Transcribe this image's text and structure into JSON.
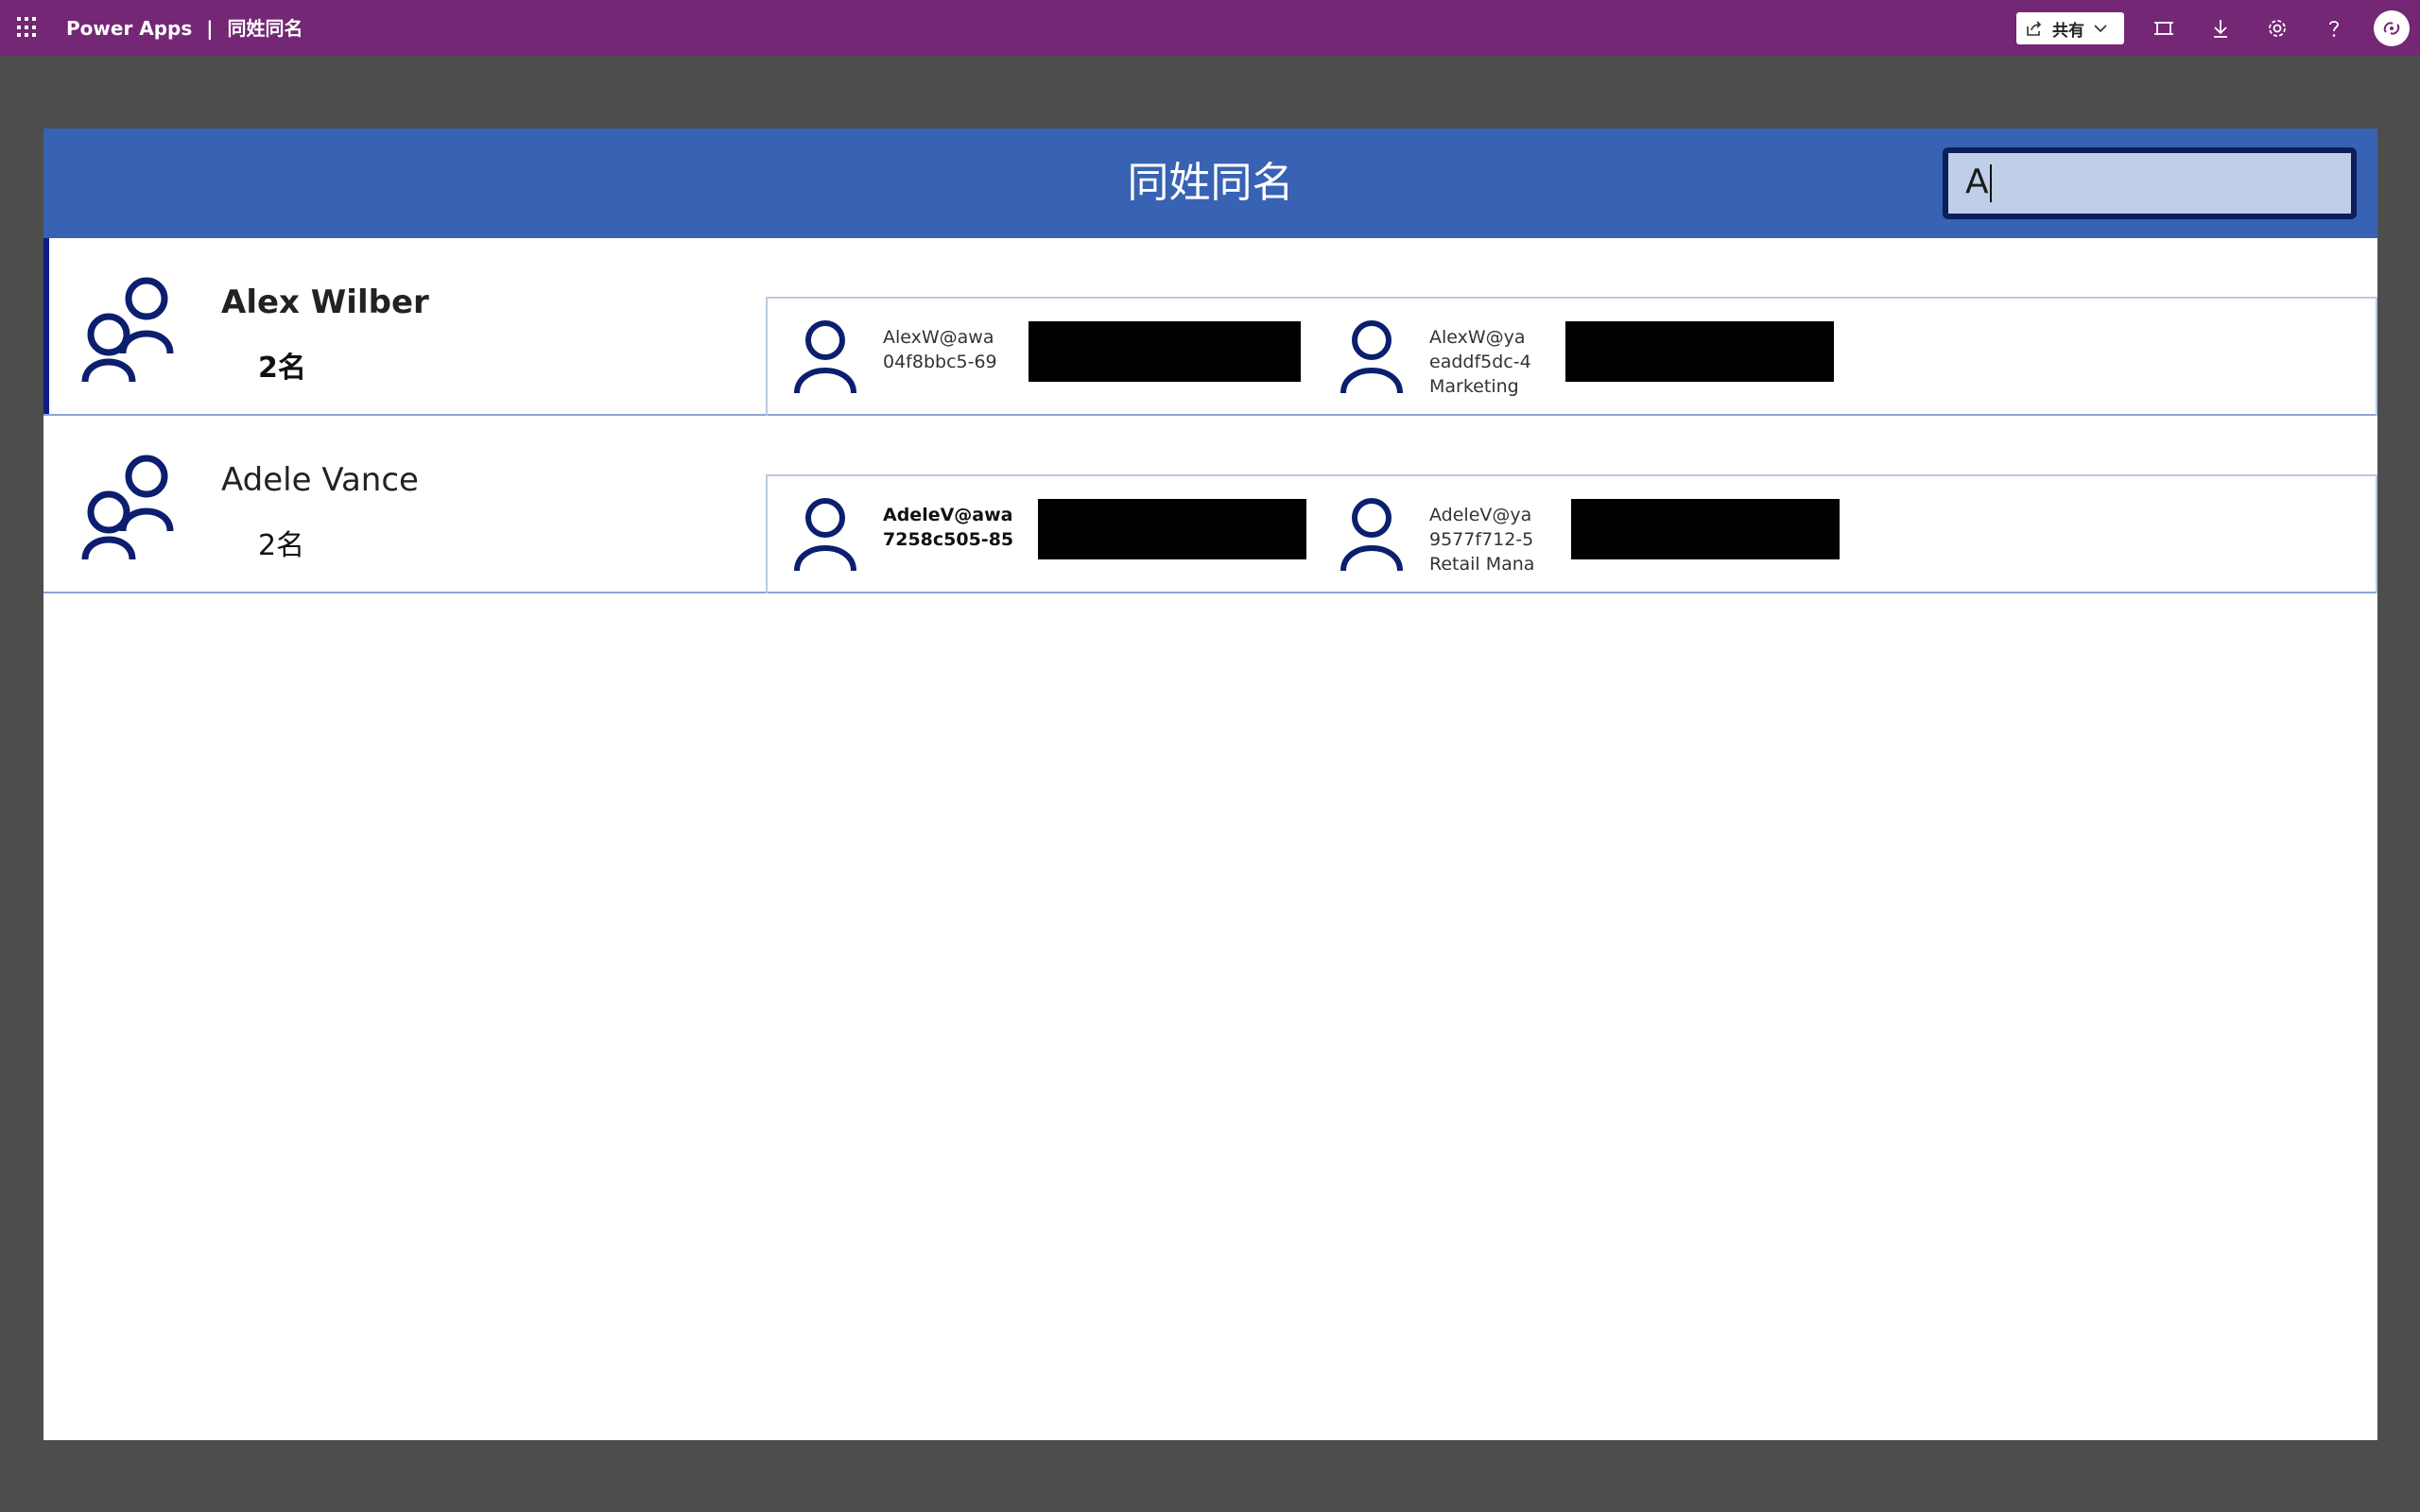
{
  "topbar": {
    "app_name": "Power Apps",
    "separator": "|",
    "app_title": "同姓同名",
    "share_label": "共有",
    "bg_color": "#742774"
  },
  "app": {
    "header_title": "同姓同名",
    "search_value": "A",
    "header_color": "#3862b3"
  },
  "groups": [
    {
      "name": "Alex Wilber",
      "count": "2名",
      "users": [
        {
          "line1": "AlexW@awa",
          "line2": "04f8bbc5-69",
          "line3": ""
        },
        {
          "line1": "AlexW@ya",
          "line2": "eaddf5dc-4",
          "line3": "Marketing"
        }
      ]
    },
    {
      "name": "Adele Vance",
      "count": "2名",
      "users": [
        {
          "line1": "AdeleV@awa",
          "line2": "7258c505-85",
          "line3": ""
        },
        {
          "line1": "AdeleV@ya",
          "line2": "9577f712-5",
          "line3": "Retail Mana"
        }
      ]
    }
  ]
}
